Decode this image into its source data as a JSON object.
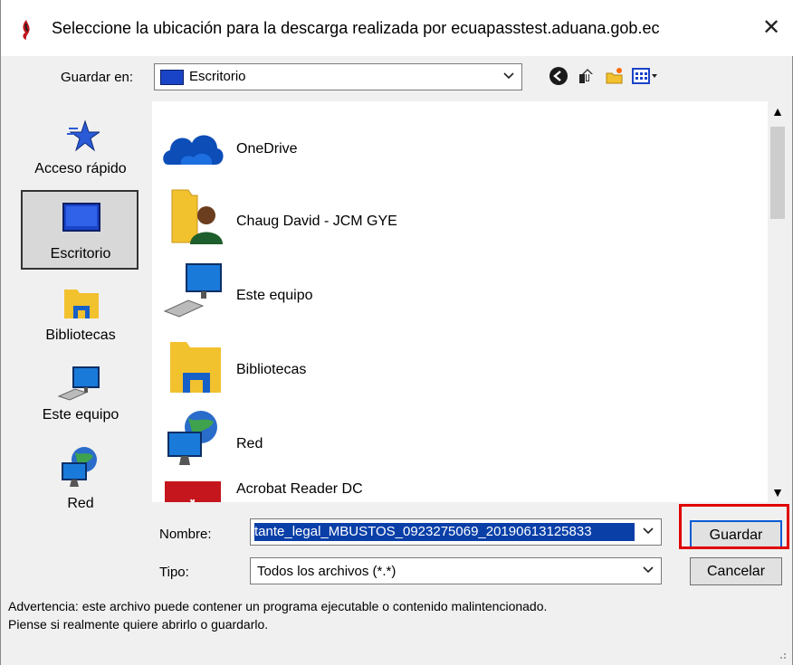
{
  "window": {
    "title": "Seleccione la ubicación para la descarga realizada por ecuapasstest.aduana.gob.ec",
    "close_glyph": "✕"
  },
  "save_in": {
    "label": "Guardar en:",
    "value": "Escritorio",
    "toolbar_icons": [
      "back-icon",
      "up-folder-icon",
      "new-folder-icon",
      "view-menu-icon"
    ]
  },
  "places": [
    {
      "label": "Acceso rápido",
      "icon": "star-icon"
    },
    {
      "label": "Escritorio",
      "icon": "desktop-icon",
      "selected": true
    },
    {
      "label": "Bibliotecas",
      "icon": "library-folder-icon"
    },
    {
      "label": "Este equipo",
      "icon": "computer-icon"
    },
    {
      "label": "Red",
      "icon": "network-icon"
    }
  ],
  "files": [
    {
      "name": "OneDrive",
      "icon": "cloud-icon"
    },
    {
      "name": "Chaug David - JCM GYE",
      "icon": "user-folder-icon"
    },
    {
      "name": "Este equipo",
      "icon": "computer-icon"
    },
    {
      "name": "Bibliotecas",
      "icon": "library-folder-icon"
    },
    {
      "name": "Red",
      "icon": "network-icon"
    },
    {
      "name": "Acrobat Reader DC",
      "icon": "acrobat-icon"
    }
  ],
  "filename": {
    "label": "Nombre:",
    "value": "tante_legal_MBUSTOS_0923275069_20190613125833"
  },
  "filetype": {
    "label": "Tipo:",
    "value": "Todos los archivos (*.*)"
  },
  "buttons": {
    "save": "Guardar",
    "cancel": "Cancelar"
  },
  "warning": {
    "line1": "Advertencia: este archivo puede contener un programa ejecutable o contenido malintencionado.",
    "line2": "Piense si realmente quiere abrirlo o guardarlo."
  },
  "colors": {
    "selection": "#0a3fa8",
    "highlight_box": "#e00000",
    "dialog_bg": "#f0f0f0"
  }
}
